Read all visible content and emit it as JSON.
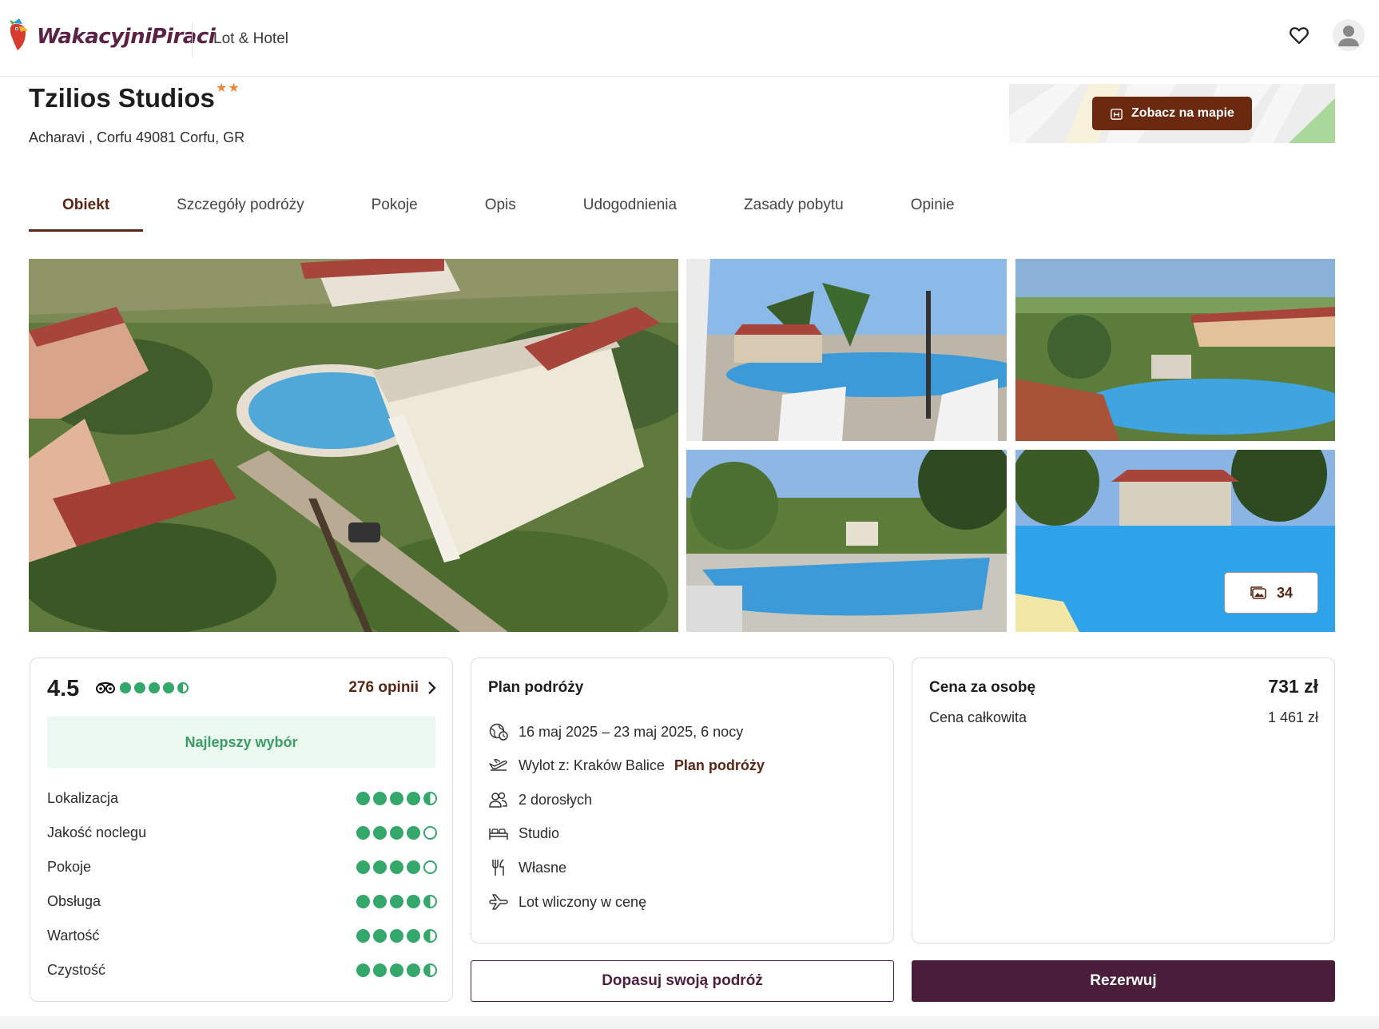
{
  "header": {
    "logo_text": "WakacyjniPiraci",
    "product_label": "Lot & Hotel"
  },
  "hotel": {
    "name": "Tzilios Studios",
    "stars": "★★",
    "star_count": 2,
    "address": "Acharavi , Corfu 49081 Corfu, GR",
    "map_button": "Zobacz na mapie"
  },
  "tabs": [
    {
      "label": "Obiekt",
      "active": true
    },
    {
      "label": "Szczegóły podróży",
      "active": false
    },
    {
      "label": "Pokoje",
      "active": false
    },
    {
      "label": "Opis",
      "active": false
    },
    {
      "label": "Udogodnienia",
      "active": false
    },
    {
      "label": "Zasady pobytu",
      "active": false
    },
    {
      "label": "Opinie",
      "active": false
    }
  ],
  "gallery": {
    "photo_count": "34"
  },
  "rating": {
    "score": "4.5",
    "tripadvisor_score": 4.5,
    "reviews_link": "276 opinii",
    "badge": "Najlepszy wybór",
    "items": [
      {
        "label": "Lokalizacja",
        "score": 4.5
      },
      {
        "label": "Jakość noclegu",
        "score": 4
      },
      {
        "label": "Pokoje",
        "score": 4
      },
      {
        "label": "Obsługa",
        "score": 4.5
      },
      {
        "label": "Wartość",
        "score": 4.5
      },
      {
        "label": "Czystość",
        "score": 4.5
      }
    ]
  },
  "plan": {
    "title": "Plan podróży",
    "dates": "16 maj 2025 – 23 maj 2025, 6 nocy",
    "departure": "Wylot z: Kraków Balice",
    "departure_link": "Plan podróży",
    "travellers": "2 dorosłych",
    "room": "Studio",
    "board": "Własne",
    "flight": "Lot wliczony w cenę"
  },
  "price": {
    "per_person_label": "Cena za osobę",
    "per_person_value": "731 zł",
    "total_label": "Cena całkowita",
    "total_value": "1 461 zł"
  },
  "actions": {
    "customize": "Dopasuj swoją podróż",
    "book": "Rezerwuj"
  },
  "colors": {
    "brand_plum": "#4a1d3a",
    "brand_brown": "#6b2a10",
    "rating_green": "#34a76a",
    "star_orange": "#f0883a"
  }
}
